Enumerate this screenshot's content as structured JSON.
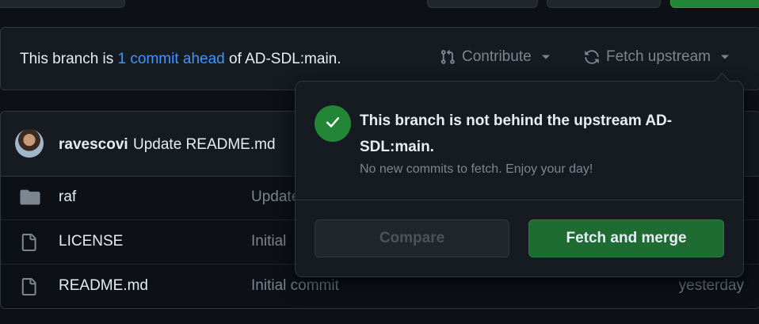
{
  "branch_bar": {
    "prefix": "This branch is ",
    "link": "1 commit ahead",
    "suffix": " of AD-SDL:main.",
    "contribute_label": "Contribute",
    "fetch_upstream_label": "Fetch upstream"
  },
  "latest_commit": {
    "author": "ravescovi",
    "message": "Update README.md"
  },
  "files": [
    {
      "name": "raf",
      "type": "folder",
      "commit": "Update",
      "date": ""
    },
    {
      "name": "LICENSE",
      "type": "file",
      "commit": "Initial",
      "date": ""
    },
    {
      "name": "README.md",
      "type": "file",
      "commit": "Initial commit",
      "date": "yesterday"
    }
  ],
  "popover": {
    "title": "This branch is not behind the upstream AD-SDL:main.",
    "subtitle": "No new commits to fetch. Enjoy your day!",
    "compare_label": "Compare",
    "fetch_merge_label": "Fetch and merge"
  },
  "colors": {
    "background": "#0d1117",
    "panel": "#161b22",
    "border": "#30363d",
    "link": "#4493f8",
    "success": "#238636",
    "muted": "#7d8590"
  },
  "icons": {
    "contribute": "git-pull-request-icon",
    "fetch": "sync-icon",
    "success": "check-icon",
    "folder": "folder-icon",
    "file": "file-icon"
  }
}
